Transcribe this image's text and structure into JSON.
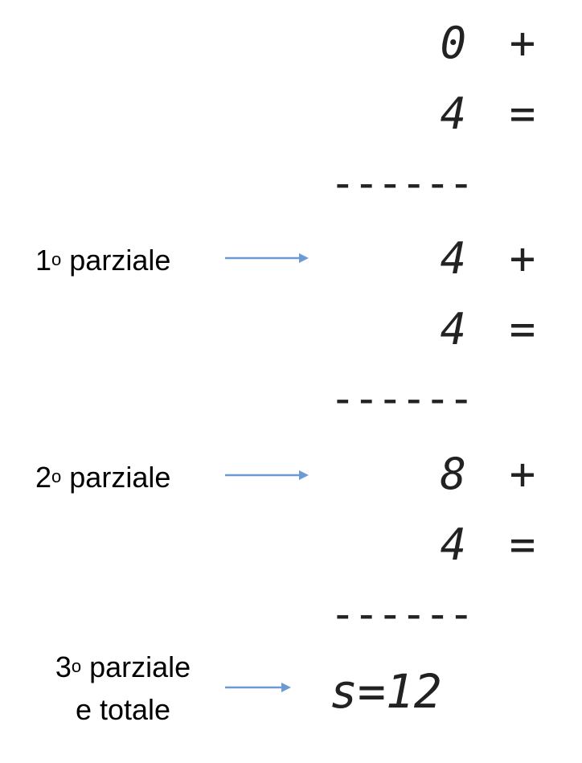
{
  "rows": [
    {
      "number": "0",
      "operator": "+"
    },
    {
      "number": "4",
      "operator": "="
    },
    {
      "number": "4",
      "operator": "+"
    },
    {
      "number": "4",
      "operator": "="
    },
    {
      "number": "8",
      "operator": "+"
    },
    {
      "number": "4",
      "operator": "="
    }
  ],
  "rule": "------",
  "total": "s=12",
  "labels": {
    "p1": {
      "num": "1",
      "sup": "o",
      "text": " parziale"
    },
    "p2": {
      "num": "2",
      "sup": "o",
      "text": " parziale"
    },
    "p3": {
      "num": "3",
      "sup": "o",
      "line1": " parziale",
      "line2": "e totale"
    }
  },
  "colors": {
    "arrow": "#6b9bd2"
  }
}
